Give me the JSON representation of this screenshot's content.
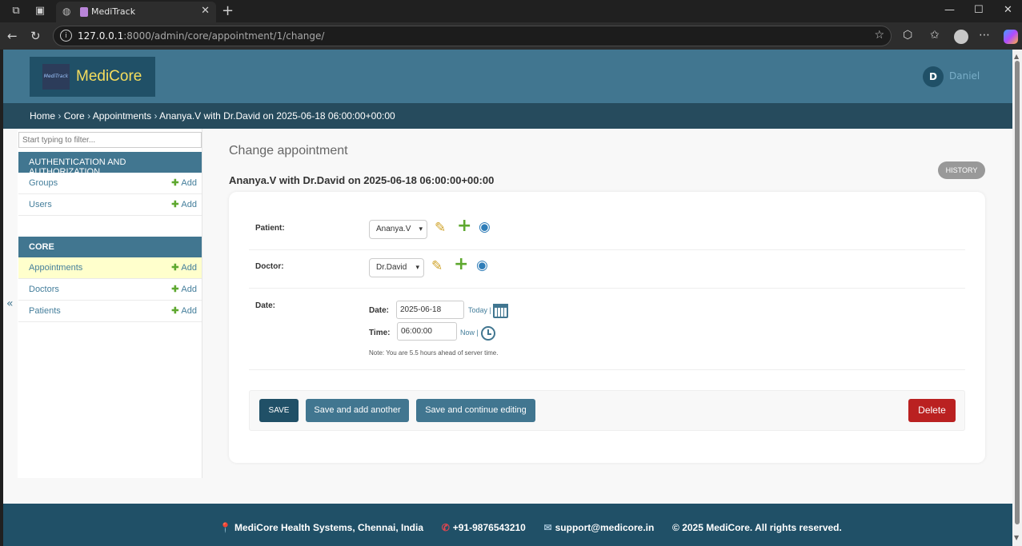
{
  "browser": {
    "tab_title": "MediTrack",
    "url_host": "127.0.0.1",
    "url_rest": ":8000/admin/core/appointment/1/change/"
  },
  "header": {
    "brand_logo_text": "MediTrack",
    "brand_name": "MediCore",
    "user_initial": "D",
    "user_name": "Daniel"
  },
  "breadcrumbs": [
    "Home",
    "Core",
    "Appointments",
    "Ananya.V with Dr.David on 2025-06-18 06:00:00+00:00"
  ],
  "sidebar": {
    "filter_placeholder": "Start typing to filter...",
    "auth_caption": "AUTHENTICATION AND AUTHORIZATION",
    "core_caption": "CORE",
    "add_label": "Add",
    "auth_items": [
      {
        "label": "Groups"
      },
      {
        "label": "Users"
      }
    ],
    "core_items": [
      {
        "label": "Appointments"
      },
      {
        "label": "Doctors"
      },
      {
        "label": "Patients"
      }
    ]
  },
  "content": {
    "title": "Change appointment",
    "history_label": "HISTORY",
    "object_title": "Ananya.V with Dr.David on 2025-06-18 06:00:00+00:00"
  },
  "form": {
    "patient_label": "Patient:",
    "patient_value": "Ananya.V",
    "doctor_label": "Doctor:",
    "doctor_value": "Dr.David",
    "date_label": "Date:",
    "date_sub_label": "Date:",
    "date_value": "2025-06-18",
    "today_label": "Today",
    "time_sub_label": "Time:",
    "time_value": "06:00:00",
    "now_label": "Now",
    "note": "Note: You are 5.5 hours ahead of server time."
  },
  "buttons": {
    "save": "SAVE",
    "save_add_another": "Save and add another",
    "save_continue": "Save and continue editing",
    "delete": "Delete"
  },
  "footer": {
    "address": "MediCore Health Systems, Chennai, India",
    "phone": "+91-9876543210",
    "email": "support@medicore.in",
    "copyright": "© 2025 MediCore. All rights reserved."
  }
}
